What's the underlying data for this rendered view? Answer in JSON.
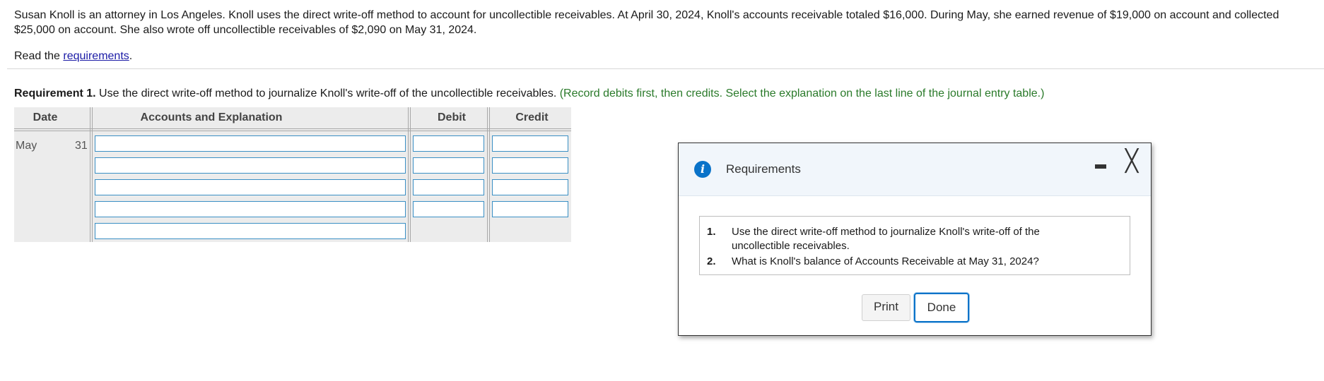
{
  "problem": {
    "text": "Susan Knoll is an attorney in Los Angeles. Knoll uses the direct write-off method to account for uncollectible receivables. At April 30, 2024, Knoll's accounts receivable totaled $16,000. During May, she earned revenue of $19,000 on account and collected $25,000 on account. She also wrote off uncollectible receivables of $2,090 on May 31, 2024.",
    "read_prefix": "Read the ",
    "read_link": "requirements",
    "read_suffix": "."
  },
  "requirement1": {
    "label": "Requirement 1.",
    "text": " Use the direct write-off method to journalize Knoll's write-off of the uncollectible receivables. ",
    "instruction": "(Record debits first, then credits. Select the explanation on the last line of the journal entry table.)"
  },
  "journal": {
    "headers": {
      "date": "Date",
      "accounts": "Accounts and Explanation",
      "debit": "Debit",
      "credit": "Credit"
    },
    "date_month": "May",
    "date_day": "31",
    "rows": [
      {
        "account": "",
        "debit": "",
        "credit": ""
      },
      {
        "account": "",
        "debit": "",
        "credit": ""
      },
      {
        "account": "",
        "debit": "",
        "credit": ""
      },
      {
        "account": "",
        "debit": "",
        "credit": ""
      },
      {
        "account": ""
      }
    ]
  },
  "dialog": {
    "title": "Requirements",
    "icon": "info-icon",
    "items": [
      {
        "num": "1.",
        "text": "Use the direct write-off method to journalize Knoll's write-off of the uncollectible receivables."
      },
      {
        "num": "2.",
        "text": "What is Knoll's balance of Accounts Receivable at May 31, 2024?"
      }
    ],
    "print_label": "Print",
    "done_label": "Done",
    "close_glyph": "╳"
  },
  "colors": {
    "link": "#1a1aa6",
    "instruction_green": "#2a7a2a",
    "input_border": "#3a8fc4",
    "accent_blue": "#0a73c9"
  }
}
